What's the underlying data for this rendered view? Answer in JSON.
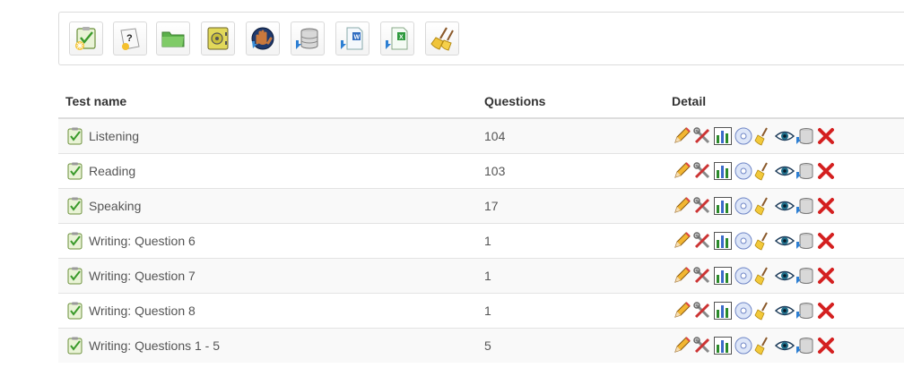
{
  "toolbar": {
    "buttons": [
      {
        "icon": "new-test-icon"
      },
      {
        "icon": "question-icon"
      },
      {
        "icon": "folder-icon"
      },
      {
        "icon": "safe-icon"
      },
      {
        "icon": "hand-icon"
      },
      {
        "icon": "database-import-icon"
      },
      {
        "icon": "word-import-icon"
      },
      {
        "icon": "excel-import-icon"
      },
      {
        "icon": "broom-icon"
      }
    ]
  },
  "table": {
    "headers": {
      "name": "Test name",
      "questions": "Questions",
      "detail": "Detail"
    },
    "rows": [
      {
        "name": "Listening",
        "questions": "104"
      },
      {
        "name": "Reading",
        "questions": "103"
      },
      {
        "name": "Speaking",
        "questions": "17"
      },
      {
        "name": "Writing: Question 6",
        "questions": "1"
      },
      {
        "name": "Writing: Question 7",
        "questions": "1"
      },
      {
        "name": "Writing: Question 8",
        "questions": "1"
      },
      {
        "name": "Writing: Questions 1 - 5",
        "questions": "5"
      }
    ],
    "actions": [
      "edit-icon",
      "settings-icon",
      "statistics-icon",
      "disc-icon",
      "clear-icon",
      "preview-icon",
      "export-icon",
      "delete-icon"
    ]
  }
}
